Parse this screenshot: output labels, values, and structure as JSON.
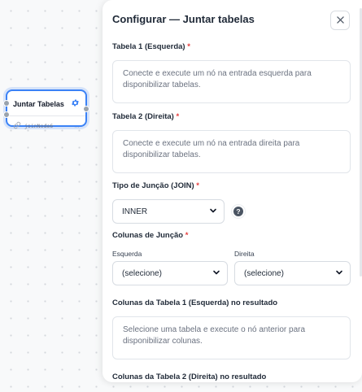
{
  "node": {
    "title": "Juntar Tabelas",
    "id": "joinNode6",
    "more": "…"
  },
  "panel": {
    "title": "Configurar — Juntar tabelas",
    "close_icon": "close-icon",
    "table1": {
      "label": "Tabela 1 (Esquerda)",
      "required": "*",
      "message": "Conecte e execute um nó na entrada esquerda para disponibilizar tabelas."
    },
    "table2": {
      "label": "Tabela 2 (Direita)",
      "required": "*",
      "message": "Conecte e execute um nó na entrada direita para disponibilizar tabelas."
    },
    "join_type": {
      "label": "Tipo de Junção (JOIN)",
      "required": "*",
      "value": "INNER",
      "help_icon": "help-icon"
    },
    "join_columns": {
      "label": "Colunas de Junção",
      "required": "*",
      "left_label": "Esquerda",
      "left_value": "(selecione)",
      "right_label": "Direita",
      "right_value": "(selecione)"
    },
    "result_cols_1": {
      "label": "Colunas da Tabela 1 (Esquerda) no resultado",
      "message": "Selecione uma tabela e execute o nó anterior para disponibilizar colunas."
    },
    "result_cols_2": {
      "label": "Colunas da Tabela 2 (Direita) no resultado"
    }
  },
  "colors": {
    "accent": "#3b82f6",
    "required": "#e53e3e"
  }
}
